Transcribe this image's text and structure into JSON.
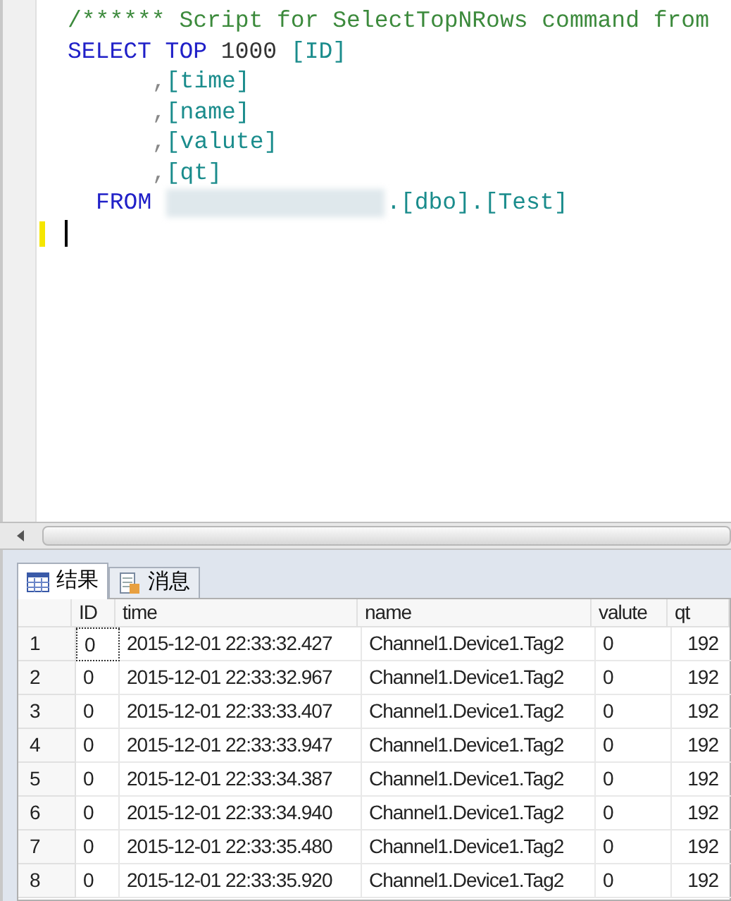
{
  "editor": {
    "lines": [
      {
        "kind": "plain",
        "tokens": [
          {
            "kind": "comment",
            "text": "/****** Script for SelectTopNRows command from"
          }
        ]
      },
      {
        "kind": "plain",
        "tokens": [
          {
            "kind": "keyword",
            "text": "SELECT TOP "
          },
          {
            "kind": "number",
            "text": "1000 "
          },
          {
            "kind": "ident",
            "text": "[ID]"
          }
        ]
      },
      {
        "kind": "column",
        "tokens": [
          {
            "kind": "punct",
            "text": ","
          },
          {
            "kind": "ident",
            "text": "[time]"
          }
        ]
      },
      {
        "kind": "column",
        "tokens": [
          {
            "kind": "punct",
            "text": ","
          },
          {
            "kind": "ident",
            "text": "[name]"
          }
        ]
      },
      {
        "kind": "column",
        "tokens": [
          {
            "kind": "punct",
            "text": ","
          },
          {
            "kind": "ident",
            "text": "[valute]"
          }
        ]
      },
      {
        "kind": "column",
        "tokens": [
          {
            "kind": "punct",
            "text": ","
          },
          {
            "kind": "ident",
            "text": "[qt]"
          }
        ]
      },
      {
        "kind": "from",
        "tokens": [
          {
            "kind": "keyword",
            "text": "FROM "
          },
          {
            "kind": "redacted"
          },
          {
            "kind": "ident",
            "text": ".[dbo].[Test]"
          }
        ]
      },
      {
        "kind": "cursor"
      }
    ]
  },
  "result_tabs": [
    {
      "label": "结果",
      "selected": true
    },
    {
      "label": "消息",
      "selected": false
    }
  ],
  "table": {
    "columns": [
      "ID",
      "time",
      "name",
      "valute",
      "qt"
    ],
    "rows": [
      {
        "row_number": "1",
        "cells": [
          "0",
          "2015-12-01 22:33:32.427",
          "Channel1.Device1.Tag2",
          "0",
          "192"
        ],
        "focused": true
      },
      {
        "row_number": "2",
        "cells": [
          "0",
          "2015-12-01 22:33:32.967",
          "Channel1.Device1.Tag2",
          "0",
          "192"
        ]
      },
      {
        "row_number": "3",
        "cells": [
          "0",
          "2015-12-01 22:33:33.407",
          "Channel1.Device1.Tag2",
          "0",
          "192"
        ]
      },
      {
        "row_number": "4",
        "cells": [
          "0",
          "2015-12-01 22:33:33.947",
          "Channel1.Device1.Tag2",
          "0",
          "192"
        ]
      },
      {
        "row_number": "5",
        "cells": [
          "0",
          "2015-12-01 22:33:34.387",
          "Channel1.Device1.Tag2",
          "0",
          "192"
        ]
      },
      {
        "row_number": "6",
        "cells": [
          "0",
          "2015-12-01 22:33:34.940",
          "Channel1.Device1.Tag2",
          "0",
          "192"
        ]
      },
      {
        "row_number": "7",
        "cells": [
          "0",
          "2015-12-01 22:33:35.480",
          "Channel1.Device1.Tag2",
          "0",
          "192"
        ]
      },
      {
        "row_number": "8",
        "cells": [
          "0",
          "2015-12-01 22:33:35.920",
          "Channel1.Device1.Tag2",
          "0",
          "192"
        ]
      }
    ]
  }
}
